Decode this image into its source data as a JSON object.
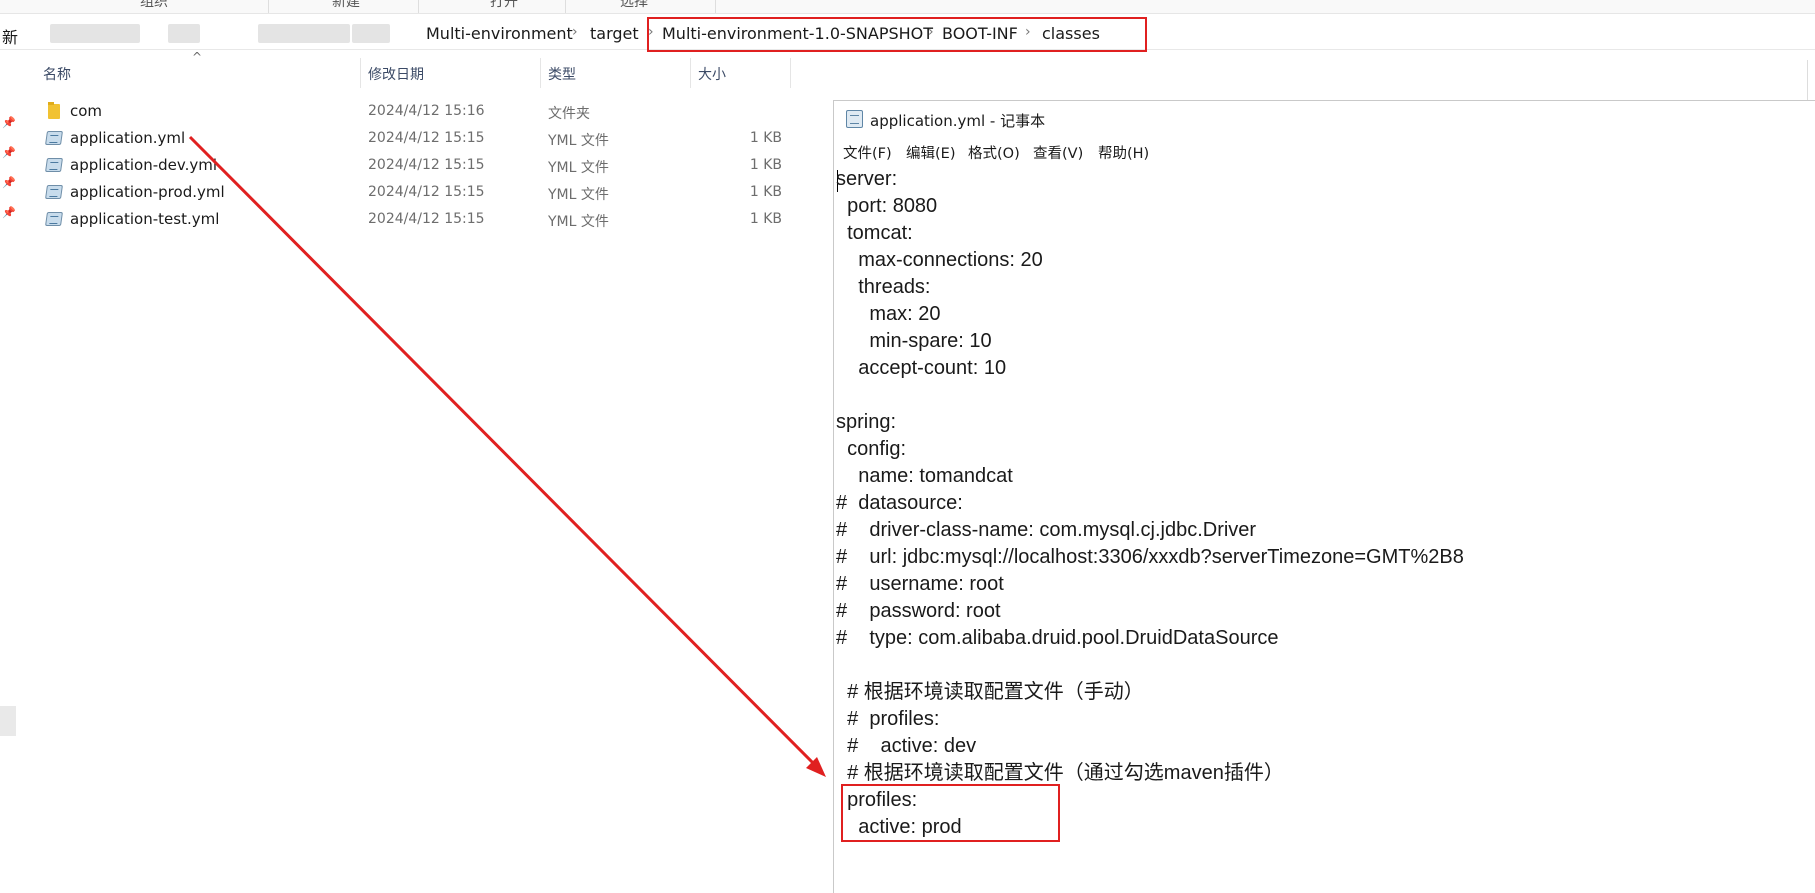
{
  "ribbon": {
    "groups": [
      "组织",
      "新建",
      "打开",
      "选择"
    ]
  },
  "addressbar": {
    "first_crumb": "新",
    "crumbs": [
      "Multi-environment",
      "target",
      "Multi-environment-1.0-SNAPSHOT",
      "BOOT-INF",
      "classes"
    ],
    "separator": "›"
  },
  "file_list": {
    "columns": [
      "名称",
      "修改日期",
      "类型",
      "大小"
    ],
    "sort_indicator": "^",
    "rows": [
      {
        "name": "com",
        "date": "2024/4/12 15:16",
        "type": "文件夹",
        "size": "",
        "icon": "folder-icon"
      },
      {
        "name": "application.yml",
        "date": "2024/4/12 15:15",
        "type": "YML 文件",
        "size": "1 KB",
        "icon": "yml-file-icon"
      },
      {
        "name": "application-dev.yml",
        "date": "2024/4/12 15:15",
        "type": "YML 文件",
        "size": "1 KB",
        "icon": "yml-file-icon"
      },
      {
        "name": "application-prod.yml",
        "date": "2024/4/12 15:15",
        "type": "YML 文件",
        "size": "1 KB",
        "icon": "yml-file-icon"
      },
      {
        "name": "application-test.yml",
        "date": "2024/4/12 15:15",
        "type": "YML 文件",
        "size": "1 KB",
        "icon": "yml-file-icon"
      }
    ]
  },
  "notepad": {
    "title": "application.yml - 记事本",
    "menus": [
      "文件(F)",
      "编辑(E)",
      "格式(O)",
      "查看(V)",
      "帮助(H)"
    ],
    "lines": [
      "server:",
      "  port: 8080",
      "  tomcat:",
      "    max-connections: 20",
      "    threads:",
      "      max: 20",
      "      min-spare: 10",
      "    accept-count: 10",
      "",
      "spring:",
      "  config:",
      "    name: tomandcat",
      "#  datasource:",
      "#    driver-class-name: com.mysql.cj.jdbc.Driver",
      "#    url: jdbc:mysql://localhost:3306/xxxdb?serverTimezone=GMT%2B8",
      "#    username: root",
      "#    password: root",
      "#    type: com.alibaba.druid.pool.DruidDataSource",
      "",
      "  # 根据环境读取配置文件（手动）",
      "  #  profiles:",
      "  #    active: dev",
      "  # 根据环境读取配置文件（通过勾选maven插件）",
      "  profiles:",
      "    active: prod"
    ]
  },
  "annotation": {
    "color": "#e02020"
  }
}
